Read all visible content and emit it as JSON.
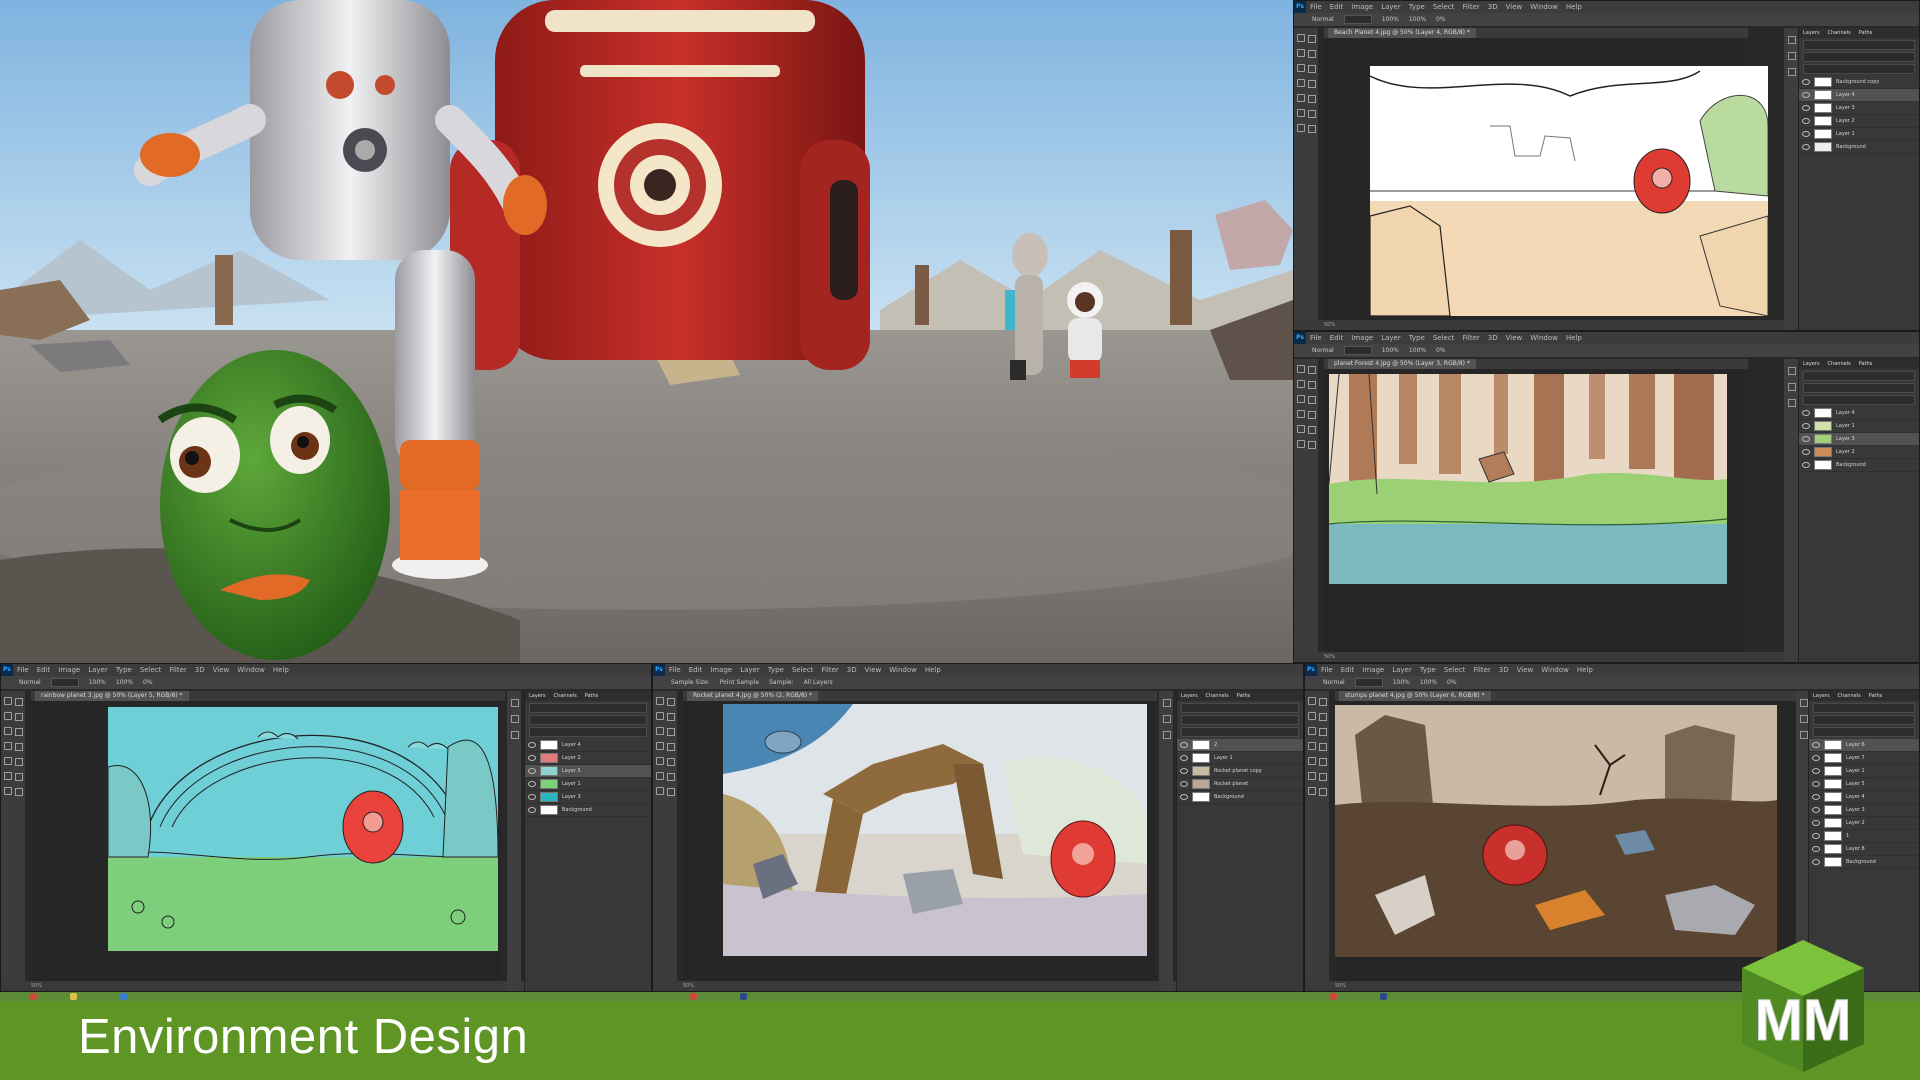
{
  "banner": {
    "title": "Environment Design"
  },
  "logo": {
    "letters": "MM"
  },
  "ps_menu": [
    "File",
    "Edit",
    "Image",
    "Layer",
    "Type",
    "Select",
    "Filter",
    "3D",
    "View",
    "Window",
    "Help"
  ],
  "colors": {
    "banner_green": "#5f9525",
    "ps_dark": "#282828",
    "ps_panel": "#383838",
    "ps_accent": "#31a8ff"
  },
  "windows": {
    "beach": {
      "tab": "Beach Planet 4.jpg @ 50% (Layer 4, RGB/8) *",
      "opt": {
        "mode": "Normal",
        "opacity": "100%",
        "flow": "100%",
        "smoothing": "0%"
      },
      "status": "50%",
      "panel_tabs": [
        "Layers",
        "Channels",
        "Paths"
      ],
      "layers": [
        "Background copy",
        "Layer 4",
        "Layer 3",
        "Layer 2",
        "Layer 1",
        "Background"
      ]
    },
    "forest": {
      "tab": "planet Forest 4.jpg @ 50% (Layer 3, RGB/8) *",
      "opt": {
        "mode": "Normal",
        "opacity": "100%",
        "flow": "100%",
        "smoothing": "0%"
      },
      "status": "50%",
      "panel_tabs": [
        "Layers",
        "Channels",
        "Paths"
      ],
      "layers": [
        "Layer 4",
        "Layer 1",
        "Layer 3",
        "Layer 2",
        "Background"
      ]
    },
    "rainbow": {
      "tab": "rainbow planet 3.jpg @ 50% (Layer 5, RGB/8) *",
      "opt": {
        "mode": "Normal",
        "opacity": "100%",
        "flow": "100%",
        "smoothing": "0%"
      },
      "status": "50%",
      "panel_tabs": [
        "Layers",
        "Channels",
        "Paths"
      ],
      "layers": [
        "Layer 4",
        "Layer 2",
        "Layer 5",
        "Layer 1",
        "Layer 3",
        "Background"
      ]
    },
    "rocket": {
      "tab": "Rocket planet 4.jpg @ 50% (2, RGB/8) *",
      "opt": {
        "mode": "Sample Size:",
        "opacity": "Point Sample",
        "flow": "Sample:",
        "smoothing": "All Layers"
      },
      "status": "50%",
      "panel_tabs": [
        "Layers",
        "Channels",
        "Paths"
      ],
      "layers": [
        "2",
        "Layer 1",
        "Rocket planet copy",
        "Rocket planet",
        "Background"
      ]
    },
    "stumps": {
      "tab": "stumps planet 4.jpg @ 50% (Layer 6, RGB/8) *",
      "opt": {
        "mode": "Normal",
        "opacity": "100%",
        "flow": "100%",
        "smoothing": "0%"
      },
      "status": "50%",
      "panel_tabs": [
        "Layers",
        "Channels",
        "Paths"
      ],
      "layers": [
        "Layer 6",
        "Layer 7",
        "Layer 1",
        "Layer 5",
        "Layer 4",
        "Layer 3",
        "Layer 2",
        "1",
        "Layer 8",
        "Background"
      ]
    }
  }
}
